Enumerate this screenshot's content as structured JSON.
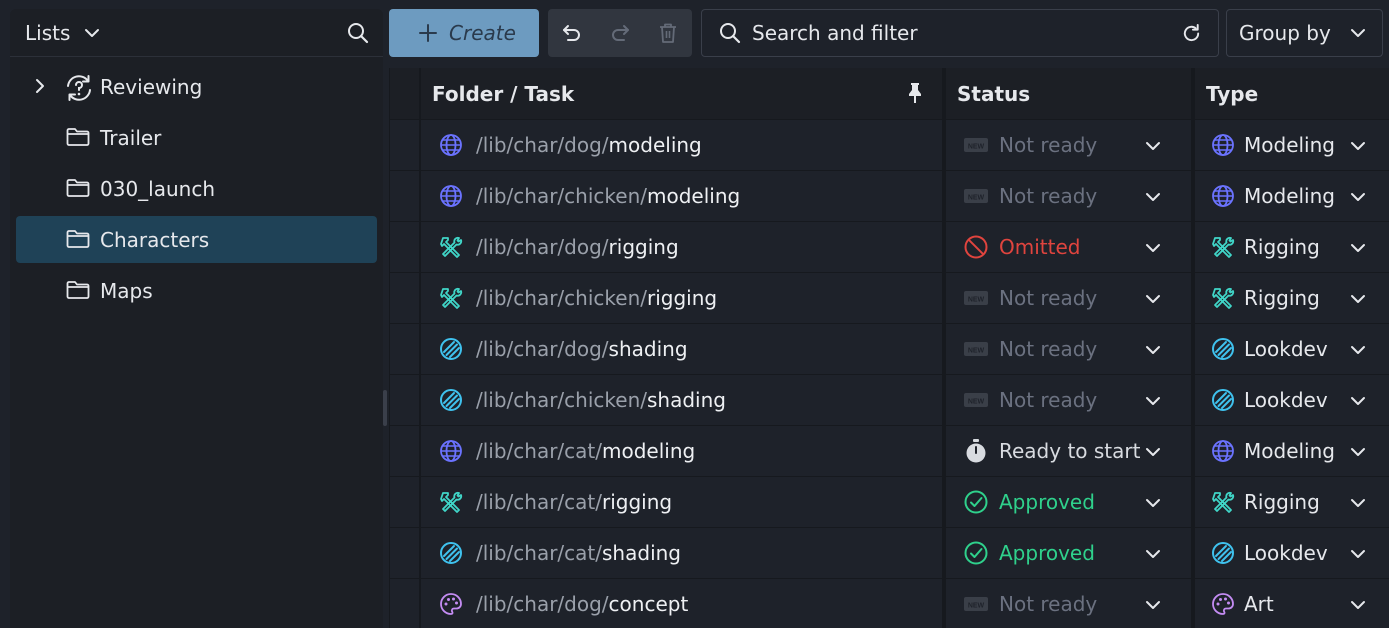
{
  "sidebar": {
    "title": "Lists",
    "items": [
      {
        "label": "Reviewing",
        "icon": "review-icon",
        "expandable": true,
        "selected": false
      },
      {
        "label": "Trailer",
        "icon": "folder-icon",
        "expandable": false,
        "selected": false
      },
      {
        "label": "030_launch",
        "icon": "folder-icon",
        "expandable": false,
        "selected": false
      },
      {
        "label": "Characters",
        "icon": "folder-icon",
        "expandable": false,
        "selected": true
      },
      {
        "label": "Maps",
        "icon": "folder-icon",
        "expandable": false,
        "selected": false
      }
    ]
  },
  "toolbar": {
    "create_label": "Create",
    "search_placeholder": "Search and filter",
    "group_by_label": "Group by"
  },
  "table": {
    "columns": [
      "Folder / Task",
      "Status",
      "Type"
    ],
    "rows": [
      {
        "prefix": "/lib/char/dog/",
        "task": "modeling",
        "status": "Not ready",
        "type": "Modeling"
      },
      {
        "prefix": "/lib/char/chicken/",
        "task": "modeling",
        "status": "Not ready",
        "type": "Modeling"
      },
      {
        "prefix": "/lib/char/dog/",
        "task": "rigging",
        "status": "Omitted",
        "type": "Rigging"
      },
      {
        "prefix": "/lib/char/chicken/",
        "task": "rigging",
        "status": "Not ready",
        "type": "Rigging"
      },
      {
        "prefix": "/lib/char/dog/",
        "task": "shading",
        "status": "Not ready",
        "type": "Lookdev"
      },
      {
        "prefix": "/lib/char/chicken/",
        "task": "shading",
        "status": "Not ready",
        "type": "Lookdev"
      },
      {
        "prefix": "/lib/char/cat/",
        "task": "modeling",
        "status": "Ready to start",
        "type": "Modeling"
      },
      {
        "prefix": "/lib/char/cat/",
        "task": "rigging",
        "status": "Approved",
        "type": "Rigging"
      },
      {
        "prefix": "/lib/char/cat/",
        "task": "shading",
        "status": "Approved",
        "type": "Lookdev"
      },
      {
        "prefix": "/lib/char/dog/",
        "task": "concept",
        "status": "Not ready",
        "type": "Art"
      }
    ]
  },
  "colors": {
    "accent": "#6d9bc0",
    "selected": "#1f4257",
    "status_not_ready": "#6b7180",
    "status_omitted": "#e0443e",
    "status_ready": "#d8dbe0",
    "status_approved": "#2fd18c",
    "type_modeling": "#6b73ff",
    "type_rigging": "#40d6c8",
    "type_lookdev": "#3fc2ee",
    "type_art": "#c48cf3"
  }
}
